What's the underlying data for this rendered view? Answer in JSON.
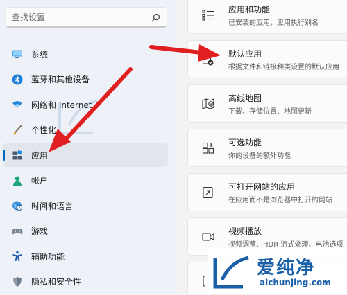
{
  "search": {
    "placeholder": "查找设置"
  },
  "nav": {
    "items": [
      {
        "label": "系统",
        "icon": "monitor-icon"
      },
      {
        "label": "蓝牙和其他设备",
        "icon": "bluetooth-icon"
      },
      {
        "label": "网络和 Internet",
        "icon": "wifi-icon"
      },
      {
        "label": "个性化",
        "icon": "brush-icon"
      },
      {
        "label": "应用",
        "icon": "apps-icon",
        "active": true
      },
      {
        "label": "帐户",
        "icon": "person-icon"
      },
      {
        "label": "时间和语言",
        "icon": "globe-clock-icon"
      },
      {
        "label": "游戏",
        "icon": "gamepad-icon"
      },
      {
        "label": "辅助功能",
        "icon": "accessibility-icon"
      },
      {
        "label": "隐私和安全性",
        "icon": "shield-icon"
      }
    ]
  },
  "cards": [
    {
      "title": "应用和功能",
      "desc": "已安装的应用，应用执行别名",
      "icon": "list-icon"
    },
    {
      "title": "默认应用",
      "desc": "根据文件和链接种类设置的默认应用",
      "icon": "default-apps-icon"
    },
    {
      "title": "离线地图",
      "desc": "下载、存储位置、地图更新",
      "icon": "map-icon"
    },
    {
      "title": "可选功能",
      "desc": "你的设备的额外功能",
      "icon": "add-feature-icon"
    },
    {
      "title": "可打开网站的应用",
      "desc": "在应用而不是浏览器中打开的网站",
      "icon": "open-web-icon"
    },
    {
      "title": "视频播放",
      "desc": "视频调整、HDR 流式处理、电池选项",
      "icon": "video-icon"
    }
  ],
  "watermark": {
    "text": "爱纯净"
  },
  "logo": {
    "cn": "爱纯净",
    "url": "aichunjing.com"
  },
  "colors": {
    "accent": "#0067c0",
    "arrow": "#e02020",
    "logo": "#1a5fa8"
  }
}
